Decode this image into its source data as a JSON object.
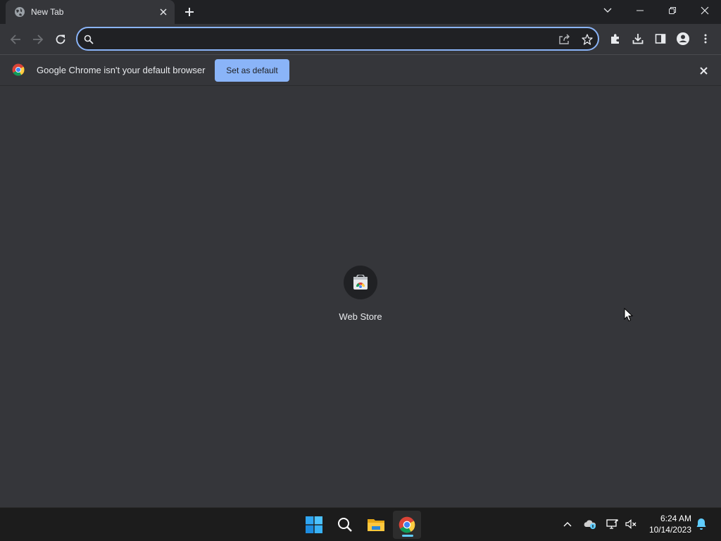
{
  "tab": {
    "title": "New Tab"
  },
  "omnibox": {
    "value": "",
    "placeholder": ""
  },
  "infobar": {
    "message": "Google Chrome isn't your default browser",
    "button_label": "Set as default"
  },
  "shortcuts": [
    {
      "label": "Web Store",
      "icon": "web-store-icon"
    }
  ],
  "taskbar": {
    "apps": [
      "windows-start",
      "search",
      "file-explorer",
      "google-chrome"
    ],
    "time": "6:24 AM",
    "date": "10/14/2023"
  },
  "colors": {
    "accent": "#8ab4f8",
    "background": "#35363a",
    "titlebar": "#202124",
    "taskbar": "#1c1c1c"
  }
}
